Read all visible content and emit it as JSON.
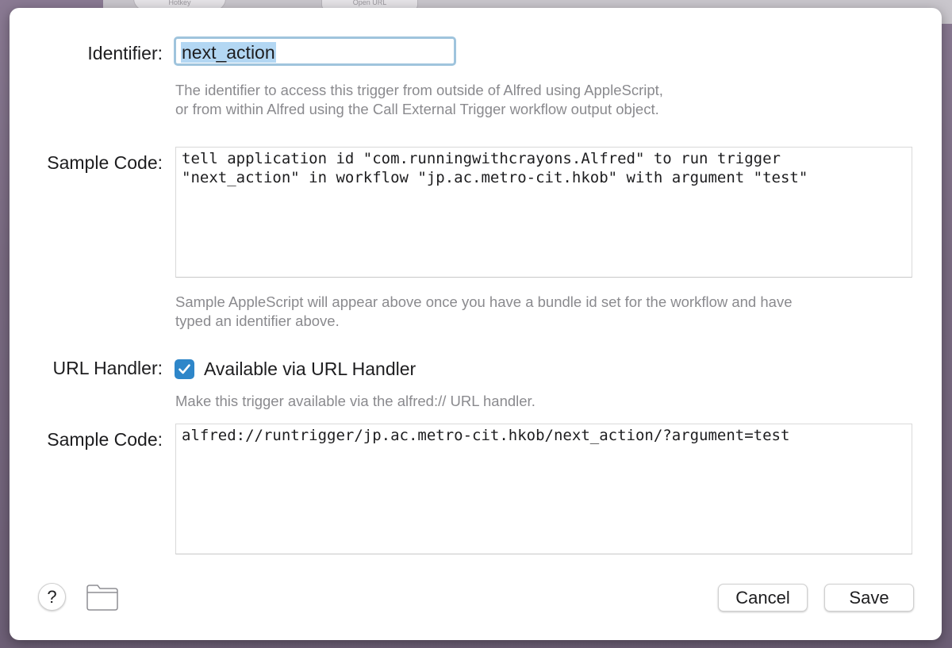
{
  "background": {
    "tab1_label": "Hotkey",
    "tab2_label": "Open URL"
  },
  "identifier": {
    "label": "Identifier:",
    "value": "next_action",
    "hint_line1": "The identifier to access this trigger from outside of Alfred using AppleScript,",
    "hint_line2": "or from within Alfred using the Call External Trigger workflow output object."
  },
  "applescript": {
    "label": "Sample Code:",
    "code": "tell application id \"com.runningwithcrayons.Alfred\" to run trigger\n\"next_action\" in workflow \"jp.ac.metro-cit.hkob\" with argument \"test\"",
    "hint_line1": "Sample AppleScript will appear above once you have a bundle id set for the workflow and have",
    "hint_line2": "typed an identifier above."
  },
  "url_handler": {
    "label": "URL Handler:",
    "checkbox_label": "Available via URL Handler",
    "checked": true,
    "hint": "Make this trigger available via the alfred:// URL handler."
  },
  "url_sample": {
    "label": "Sample Code:",
    "code": "alfred://runtrigger/jp.ac.metro-cit.hkob/next_action/?argument=test"
  },
  "footer": {
    "help_label": "?",
    "cancel_label": "Cancel",
    "save_label": "Save"
  },
  "colors": {
    "accent": "#2e86c9",
    "focus_ring": "#9fc4dd",
    "selection": "#b3d7f3",
    "hint_text": "#8a8a8e"
  },
  "icons": {
    "help": "question-mark-icon",
    "folder": "folder-icon",
    "checkmark": "checkmark-icon"
  }
}
